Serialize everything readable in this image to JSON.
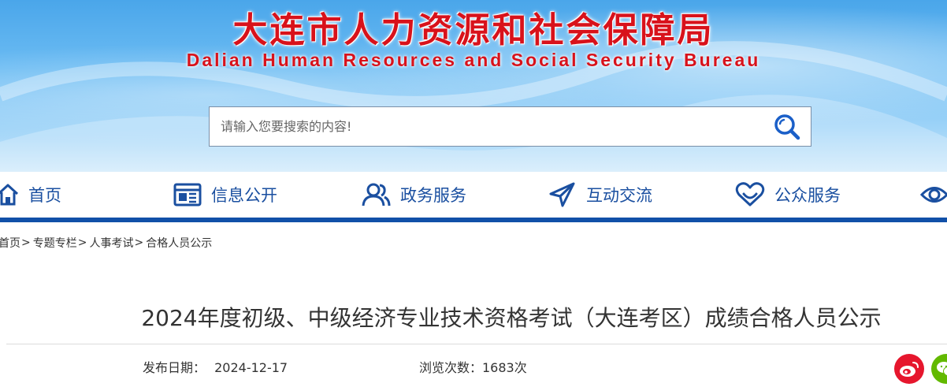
{
  "header": {
    "title": "大连市人力资源和社会保障局",
    "subtitle": "Dalian Human Resources and Social Security Bureau",
    "title_color": "#d8121b"
  },
  "search": {
    "placeholder": "请输入您要搜索的内容!",
    "icon": "search-icon"
  },
  "nav": {
    "accent_color": "#1150a8",
    "items": [
      {
        "label": "首页",
        "icon": "home-icon"
      },
      {
        "label": "信息公开",
        "icon": "newspaper-icon"
      },
      {
        "label": "政务服务",
        "icon": "people-icon"
      },
      {
        "label": "互动交流",
        "icon": "paper-plane-icon"
      },
      {
        "label": "公众服务",
        "icon": "heart-icon"
      },
      {
        "label": "",
        "icon": "eye-icon"
      }
    ]
  },
  "breadcrumb": {
    "items": [
      "首页",
      "专题专栏",
      "人事考试",
      "合格人员公示"
    ],
    "separator": ">"
  },
  "article": {
    "title": "2024年度初级、中级经济专业技术资格考试（大连考区）成绩合格人员公示",
    "publish_label": "发布日期：",
    "publish_date": "2024-12-17",
    "views_text": "浏览次数：1683次"
  },
  "share": {
    "items": [
      {
        "name": "weibo",
        "color": "#e6162d"
      },
      {
        "name": "wechat",
        "color": "#62b900"
      }
    ]
  }
}
